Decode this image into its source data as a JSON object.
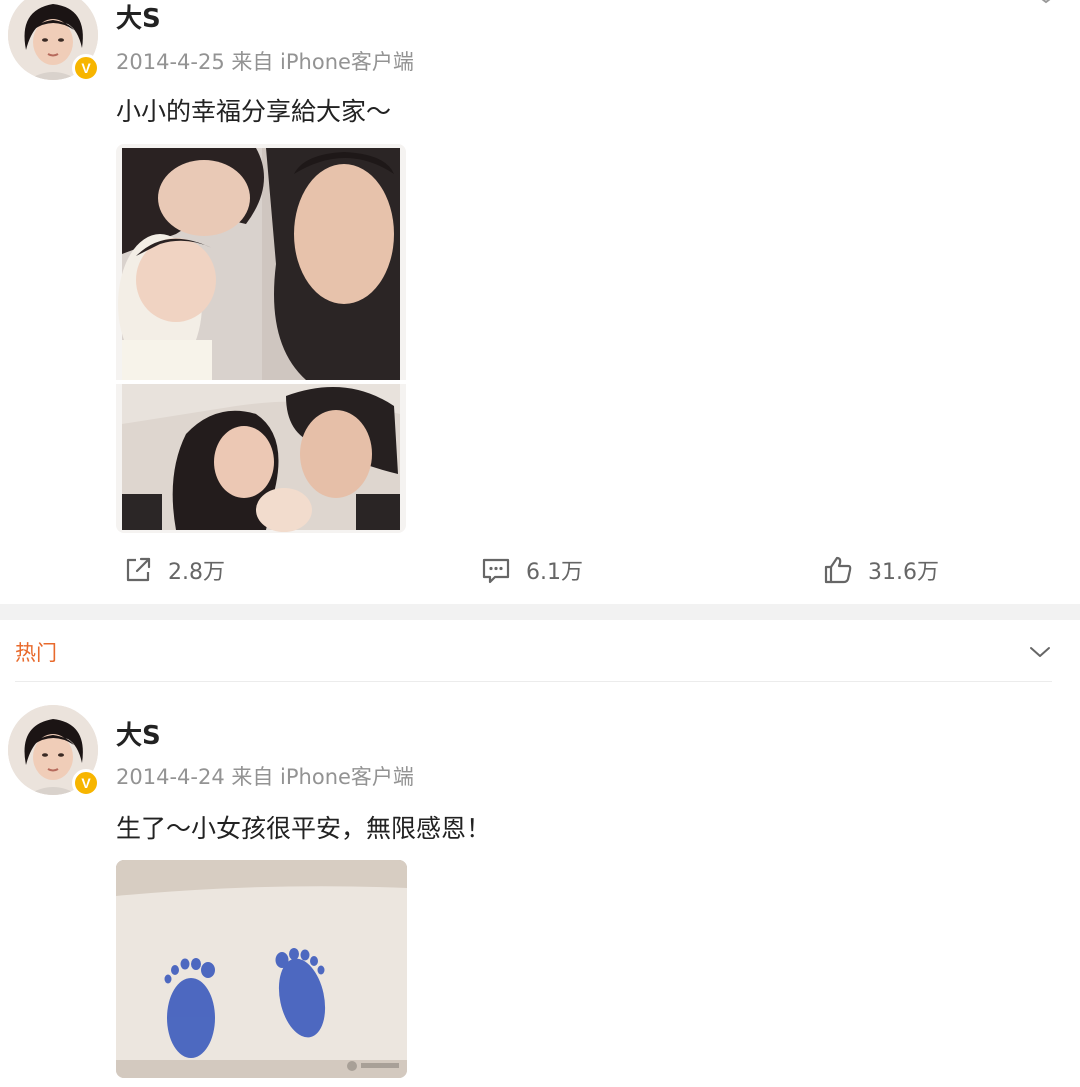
{
  "posts": [
    {
      "author": "大S",
      "verified_badge": "V",
      "date": "2014-4-25",
      "source": "来自 iPhone客户端",
      "text": "小小的幸福分享給大家～",
      "image_icon": "family-photo-collage",
      "actions": {
        "repost_count": "2.8万",
        "comment_count": "6.1万",
        "like_count": "31.6万"
      }
    },
    {
      "author": "大S",
      "verified_badge": "V",
      "date": "2014-4-24",
      "source": "来自 iPhone客户端",
      "text": "生了～小女孩很平安，無限感恩！",
      "image_icon": "baby-footprints-photo"
    }
  ],
  "hot_section": {
    "label": "热门"
  },
  "colors": {
    "accent": "#e86a2c",
    "badge": "#f7b500",
    "meta_text": "#939393",
    "divider": "#f2f2f2"
  }
}
